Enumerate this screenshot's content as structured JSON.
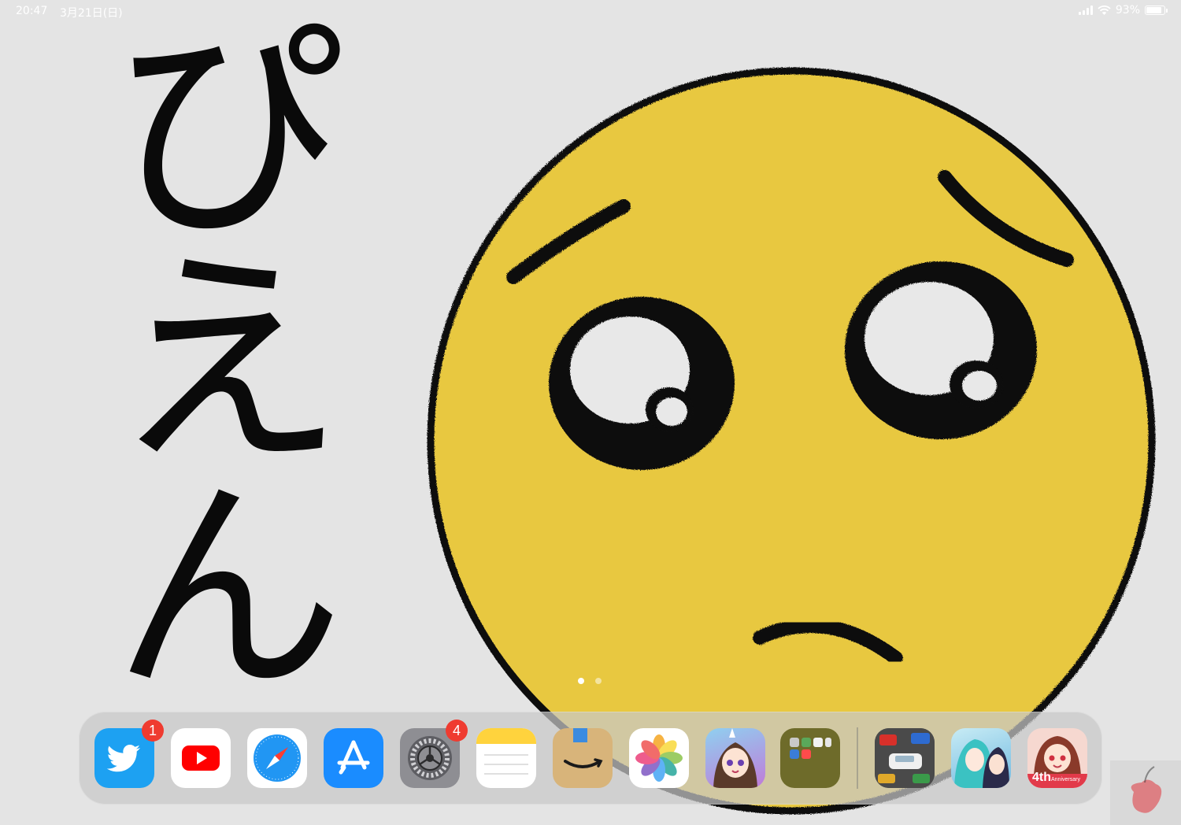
{
  "status_bar": {
    "time": "20:47",
    "date": "3月21日(日)",
    "battery": "93%",
    "battery_level": 0.93
  },
  "wallpaper": {
    "text": "ぴえん",
    "emoji_color": "#e8c840"
  },
  "page_indicator": {
    "pages": 2,
    "current": 1
  },
  "dock": {
    "apps": [
      {
        "name": "twitter-app-icon",
        "badge": "1",
        "color": "#1da1f2"
      },
      {
        "name": "youtube-app-icon",
        "badge": null,
        "color": "#ff0000"
      },
      {
        "name": "safari-app-icon",
        "badge": null,
        "color": "#1e88e5"
      },
      {
        "name": "app-store-app-icon",
        "badge": null,
        "color": "#1a8cff"
      },
      {
        "name": "settings-app-icon",
        "badge": "4",
        "color": "#8e8e93"
      },
      {
        "name": "notes-app-icon",
        "badge": null,
        "color": "#ffd33d"
      },
      {
        "name": "amazon-app-icon",
        "badge": null,
        "color": "#d8b47a"
      },
      {
        "name": "photos-app-icon",
        "badge": null,
        "color": "#ffffff"
      },
      {
        "name": "uma-musume-app-icon",
        "badge": null,
        "color": "#7ab8e8"
      },
      {
        "name": "folder-app-icon",
        "badge": null,
        "color": "#6e6b2a"
      }
    ],
    "recent_apps": [
      {
        "name": "parking-game-app-icon",
        "badge": null,
        "color": "#5a5a5a"
      },
      {
        "name": "project-sekai-app-icon",
        "badge": null,
        "color": "#9fd8ea"
      },
      {
        "name": "bang-dream-app-icon",
        "badge": null,
        "color": "#e23a4a"
      }
    ],
    "anniversary_label": "4th",
    "anniversary_sub": "Anniversary"
  }
}
